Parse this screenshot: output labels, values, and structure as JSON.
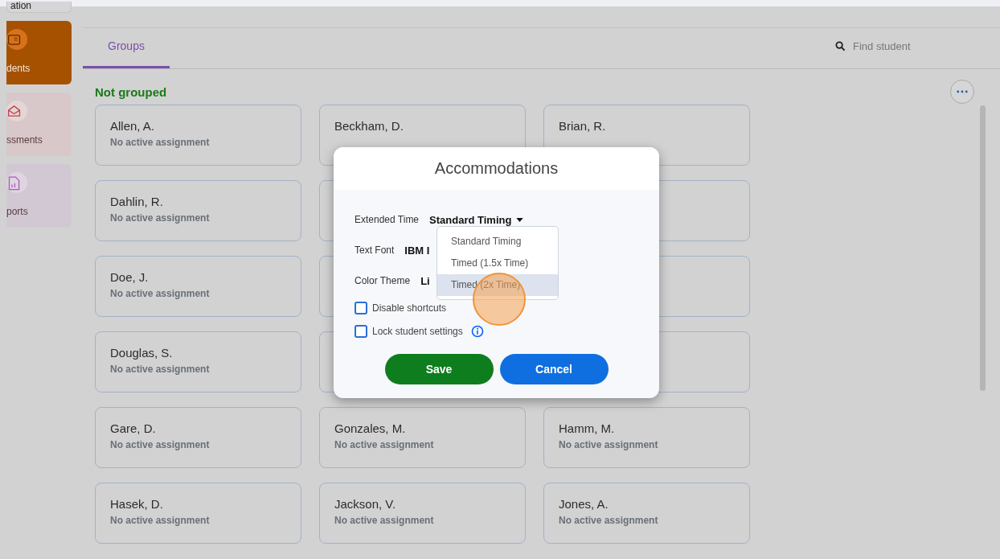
{
  "sidebar": {
    "items": [
      {
        "label": "ation",
        "kind": "button",
        "selected": false
      },
      {
        "label": "dents",
        "kind": "students",
        "selected": true
      },
      {
        "label": "ssments",
        "kind": "assessments",
        "selected": false
      },
      {
        "label": "ports",
        "kind": "reports",
        "selected": false
      }
    ]
  },
  "tabs": [
    {
      "label": "Groups",
      "selected": true
    }
  ],
  "search": {
    "placeholder": "Find student"
  },
  "section": {
    "title": "Not grouped"
  },
  "card_rows": [
    {
      "cards": [
        {
          "name": "Allen, A.",
          "status": "No active assignment"
        },
        {
          "name": "Beckham, D."
        },
        {
          "name": "Brian, R."
        }
      ]
    },
    {
      "cards": [
        {
          "name": "Dahlin, R.",
          "status": "No active assignment"
        }
      ]
    },
    {
      "cards": [
        {
          "name": "Doe, J.",
          "status": "No active assignment"
        }
      ]
    },
    {
      "cards": [
        {
          "name": "Douglas, S.",
          "status": "No active assignment"
        }
      ]
    },
    {
      "cards": [
        {
          "name": "Gare, D.",
          "status": "No active assignment"
        },
        {
          "name": "Gonzales, M.",
          "status": "No active assignment"
        },
        {
          "name": "Hamm, M.",
          "status": "No active assignment"
        }
      ]
    },
    {
      "cards": [
        {
          "name": "Hasek, D.",
          "status": "No active assignment"
        },
        {
          "name": "Jackson, V.",
          "status": "No active assignment"
        },
        {
          "name": "Jones, A.",
          "status": "No active assignment"
        }
      ]
    }
  ],
  "dialog": {
    "title": "Accommodations",
    "fields": [
      {
        "label": "Extended Time",
        "value": "Standard Timing",
        "dropdown": true
      },
      {
        "label": "Text Font",
        "value": "IBM I",
        "dropdown": false
      },
      {
        "label": "Color Theme",
        "value": "Li",
        "dropdown": false
      }
    ],
    "options": [
      {
        "label": "Standard Timing",
        "selected": false
      },
      {
        "label": "Timed (1.5x Time)",
        "selected": false
      },
      {
        "label": "Timed (2x Time)",
        "selected": true
      }
    ],
    "checkboxes": [
      {
        "label": "Disable shortcuts",
        "checked": false,
        "info": false
      },
      {
        "label": "Lock student settings",
        "checked": false,
        "info": true
      }
    ],
    "buttons": [
      {
        "label": "Save",
        "kind": "primary"
      },
      {
        "label": "Cancel",
        "kind": "secondary"
      }
    ]
  }
}
